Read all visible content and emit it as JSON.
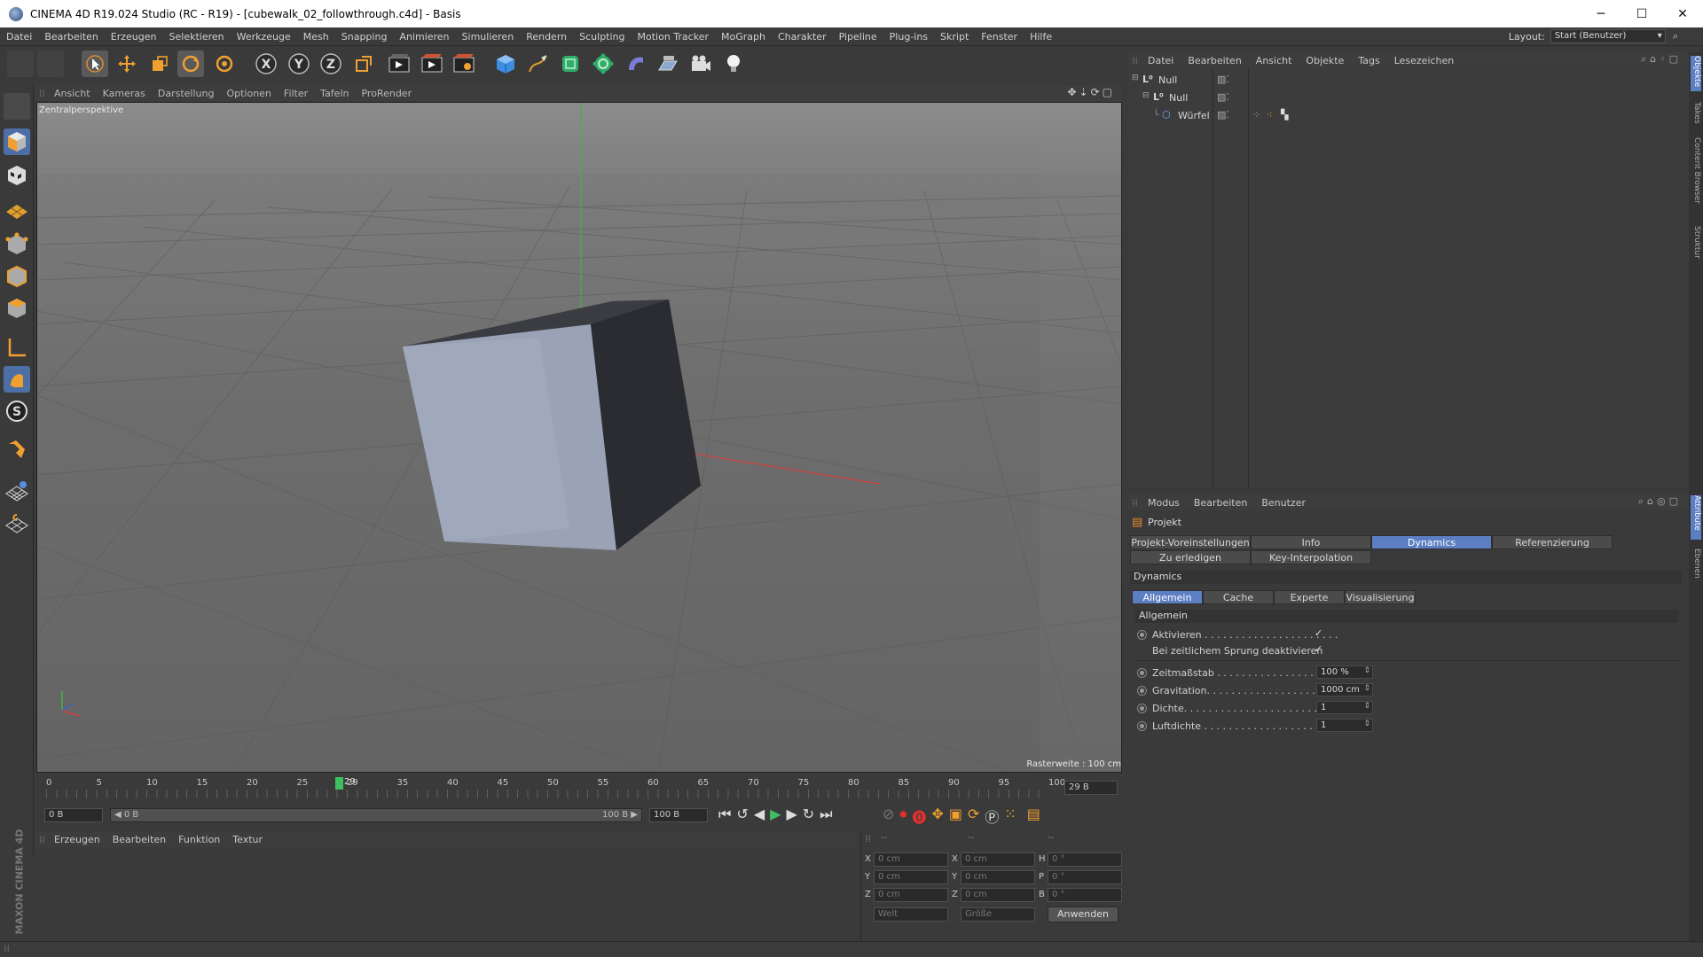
{
  "window": {
    "title": "CINEMA 4D R19.024 Studio (RC - R19) - [cubewalk_02_followthrough.c4d] - Basis",
    "minimize": "─",
    "maximize": "☐",
    "close": "✕"
  },
  "menu": {
    "items": [
      "Datei",
      "Bearbeiten",
      "Erzeugen",
      "Selektieren",
      "Werkzeuge",
      "Mesh",
      "Snapping",
      "Animieren",
      "Simulieren",
      "Rendern",
      "Sculpting",
      "Motion Tracker",
      "MoGraph",
      "Charakter",
      "Pipeline",
      "Plug-ins",
      "Skript",
      "Fenster",
      "Hilfe"
    ],
    "layout_label": "Layout:",
    "layout_value": "Start (Benutzer)"
  },
  "toolbar": {
    "axis_x": "X",
    "axis_y": "Y",
    "axis_z": "Z"
  },
  "viewport": {
    "menu": [
      "Ansicht",
      "Kameras",
      "Darstellung",
      "Optionen",
      "Filter",
      "Tafeln",
      "ProRender"
    ],
    "camera_label": "Zentralperspektive",
    "grid_label": "Rasterweite : 100 cm"
  },
  "timeline": {
    "ticks": [
      "0",
      "5",
      "10",
      "15",
      "20",
      "25",
      "29",
      "35",
      "40",
      "45",
      "50",
      "55",
      "60",
      "65",
      "70",
      "75",
      "80",
      "85",
      "90",
      "95",
      "100"
    ],
    "current_frame_badge": "29",
    "current_frame_field": "29 B",
    "start_field": "0 B",
    "range_start": "◀ 0 B",
    "range_end": "100 B ▶",
    "end_field": "100 B"
  },
  "materials": {
    "menu": [
      "Erzeugen",
      "Bearbeiten",
      "Funktion",
      "Textur"
    ]
  },
  "branding": {
    "logo_text": "MAXON CINEMA 4D"
  },
  "coordinates": {
    "rows": [
      {
        "a": "X",
        "av": "0 cm",
        "b": "X",
        "bv": "0 cm",
        "c": "H",
        "cv": "0 °"
      },
      {
        "a": "Y",
        "av": "0 cm",
        "b": "Y",
        "bv": "0 cm",
        "c": "P",
        "cv": "0 °"
      },
      {
        "a": "Z",
        "av": "0 cm",
        "b": "Z",
        "bv": "0 cm",
        "c": "B",
        "cv": "0 °"
      }
    ],
    "col_headers": [
      "--",
      "--",
      "--"
    ],
    "space_select": "Welt",
    "mode_select": "Größe",
    "apply_button": "Anwenden"
  },
  "object_manager": {
    "menu": [
      "Datei",
      "Bearbeiten",
      "Ansicht",
      "Objekte",
      "Tags",
      "Lesezeichen"
    ],
    "objects": [
      {
        "name": "Null",
        "indent": 0
      },
      {
        "name": "Null",
        "indent": 1
      },
      {
        "name": "Würfel",
        "indent": 2
      }
    ]
  },
  "attribute_manager": {
    "menu": [
      "Modus",
      "Bearbeiten",
      "Benutzer"
    ],
    "object_label": "Projekt",
    "tabs_row1": [
      "Projekt-Voreinstellungen",
      "Info",
      "Dynamics",
      "Referenzierung"
    ],
    "tabs_row2": [
      "Zu erledigen",
      "Key-Interpolation"
    ],
    "active_tab": "Dynamics",
    "section_title": "Dynamics",
    "subtabs": [
      "Allgemein",
      "Cache",
      "Experte",
      "Visualisierung"
    ],
    "active_subtab": "Allgemein",
    "group_title": "Allgemein",
    "params": [
      {
        "label": "Aktivieren . . . . . . . . . . . . . . . . . . . . . .",
        "type": "check",
        "value": "✓"
      },
      {
        "label": "Bei zeitlichem Sprung deaktivieren",
        "type": "check",
        "value": "✓"
      },
      {
        "label": "Zeitmaßstab . . . . . . . . . . . . . . . . . . .",
        "type": "num",
        "value": "100 %"
      },
      {
        "label": "Gravitation. . . . . . . . . . . . . . . . . . . .",
        "type": "num",
        "value": "1000 cm"
      },
      {
        "label": "Dichte. . . . . . . . . . . . . . . . . . . . . . .",
        "type": "num",
        "value": "1"
      },
      {
        "label": "Luftdichte . . . . . . . . . . . . . . . . . . . .",
        "type": "num",
        "value": "1"
      }
    ]
  },
  "right_tabs": [
    "Objekte",
    "Takes",
    "Content Browser",
    "Struktur",
    "Attribute",
    "Ebenen"
  ]
}
